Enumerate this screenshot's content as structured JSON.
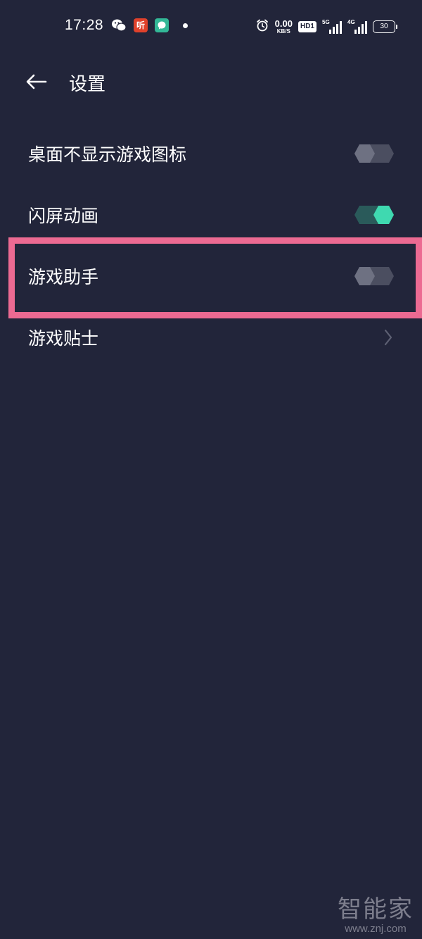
{
  "status_bar": {
    "time": "17:28",
    "ting_label": "听",
    "net_speed_value": "0.00",
    "net_speed_unit": "KB/S",
    "hd_label": "HD1",
    "sim1_network": "5G",
    "sim2_network": "4G",
    "battery_level": "30"
  },
  "header": {
    "title": "设置",
    "back_icon": "arrow-left-icon"
  },
  "settings": [
    {
      "label": "桌面不显示游戏图标",
      "control": "toggle",
      "on": false
    },
    {
      "label": "闪屏动画",
      "control": "toggle",
      "on": true
    },
    {
      "label": "游戏助手",
      "control": "toggle",
      "on": false,
      "highlighted": true
    },
    {
      "label": "游戏贴士",
      "control": "chevron"
    }
  ],
  "colors": {
    "background": "#22253a",
    "toggle_off_track": "#4b4e60",
    "toggle_off_knob": "#6e7182",
    "toggle_on_track": "#2a5a5a",
    "toggle_on_knob": "#3fd9b0",
    "highlight": "#ec6a92"
  },
  "watermark": {
    "text": "智能家",
    "url": "www.znj.com"
  }
}
